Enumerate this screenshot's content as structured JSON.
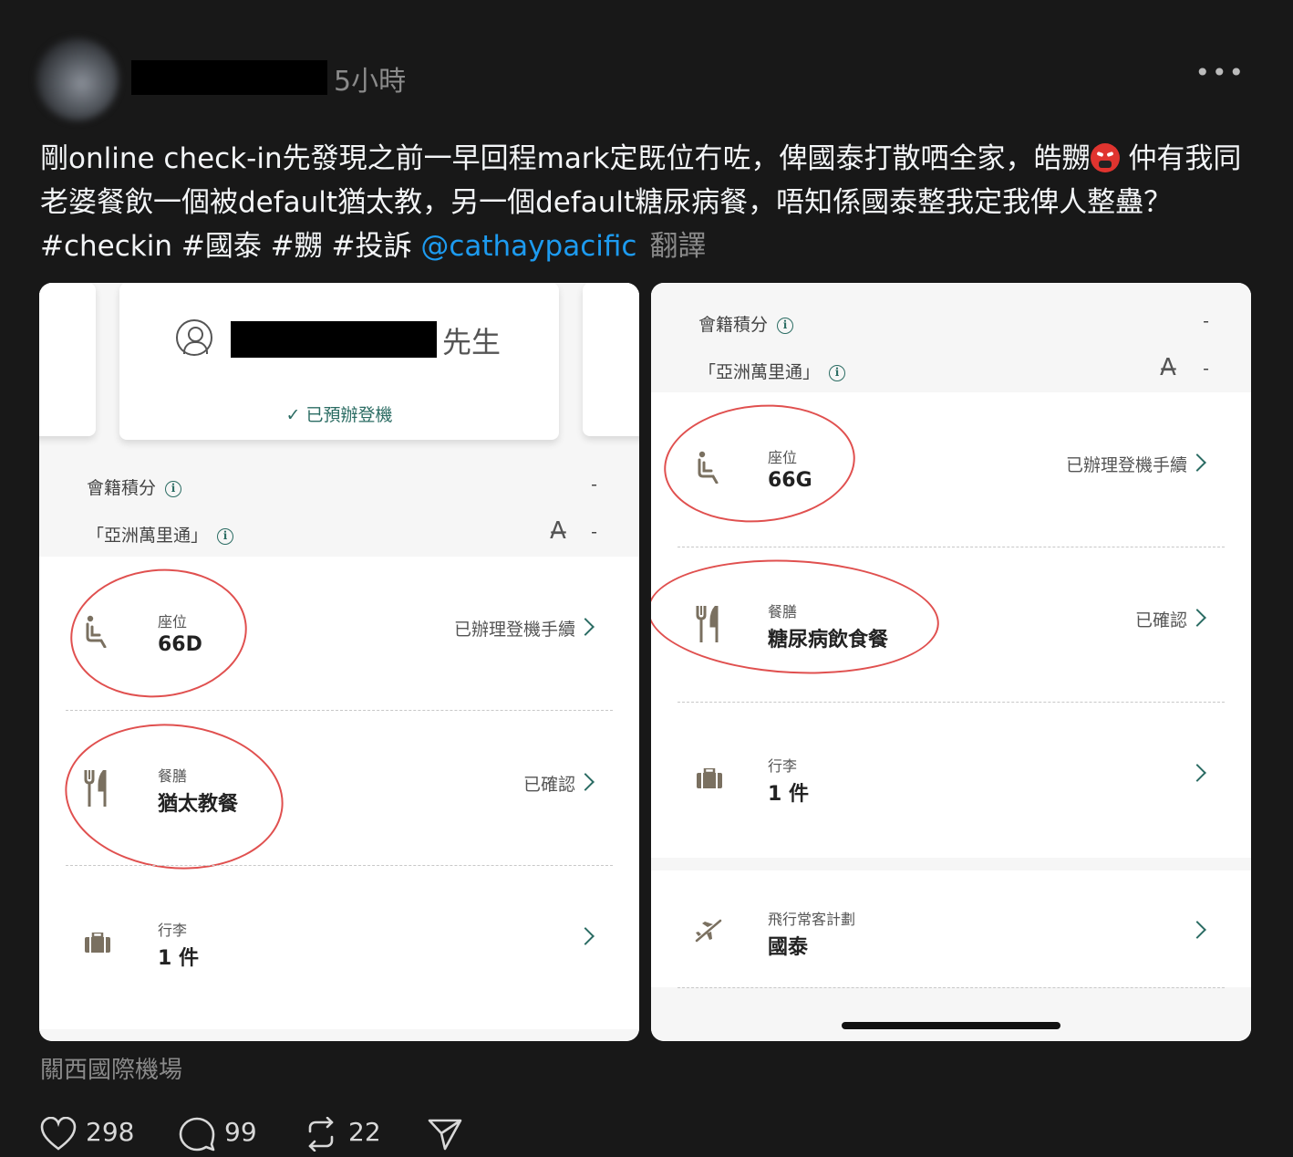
{
  "post": {
    "time": "5小時",
    "more_icon": "more-horizontal-icon",
    "text_part1": "剛online check-in先發現之前一早回程mark定既位冇咗，俾國泰打散哂全家，皓嬲",
    "emoji": "angry-face-emoji",
    "text_part2": " 仲有我同老婆餐飲一個被default猶太教，另一個default糖尿病餐，唔知係國泰整我定我俾人整蠱？ #checkin #國泰 #嬲 #投訴 ",
    "mention": "@cathaypacific",
    "translate": "翻譯",
    "location": "關西國際機場"
  },
  "left_screenshot": {
    "passenger_suffix": "先生",
    "checked_in": "✓ 已預辦登機",
    "member_points_label": "會籍積分",
    "member_points_value": "-",
    "asia_miles_label": "「亞洲萬里通」",
    "asia_miles_value": "-",
    "seat": {
      "label": "座位",
      "value": "66D",
      "status": "已辦理登機手續"
    },
    "meal": {
      "label": "餐膳",
      "value": "猶太教餐",
      "status": "已確認"
    },
    "baggage": {
      "label": "行李",
      "value": "1 件"
    }
  },
  "right_screenshot": {
    "member_points_label": "會籍積分",
    "member_points_value": "-",
    "asia_miles_label": "「亞洲萬里通」",
    "asia_miles_value": "-",
    "seat": {
      "label": "座位",
      "value": "66G",
      "status": "已辦理登機手續"
    },
    "meal": {
      "label": "餐膳",
      "value": "糖尿病飲食餐",
      "status": "已確認"
    },
    "baggage": {
      "label": "行李",
      "value": "1 件"
    },
    "frequent_flyer": {
      "label": "飛行常客計劃",
      "value": "國泰"
    }
  },
  "actions": {
    "likes": "298",
    "comments": "99",
    "reposts": "22"
  },
  "colors": {
    "background": "#181818",
    "mention": "#1d9bf0",
    "cathay_green": "#2b6c63",
    "annotation_red": "#e0504f"
  }
}
